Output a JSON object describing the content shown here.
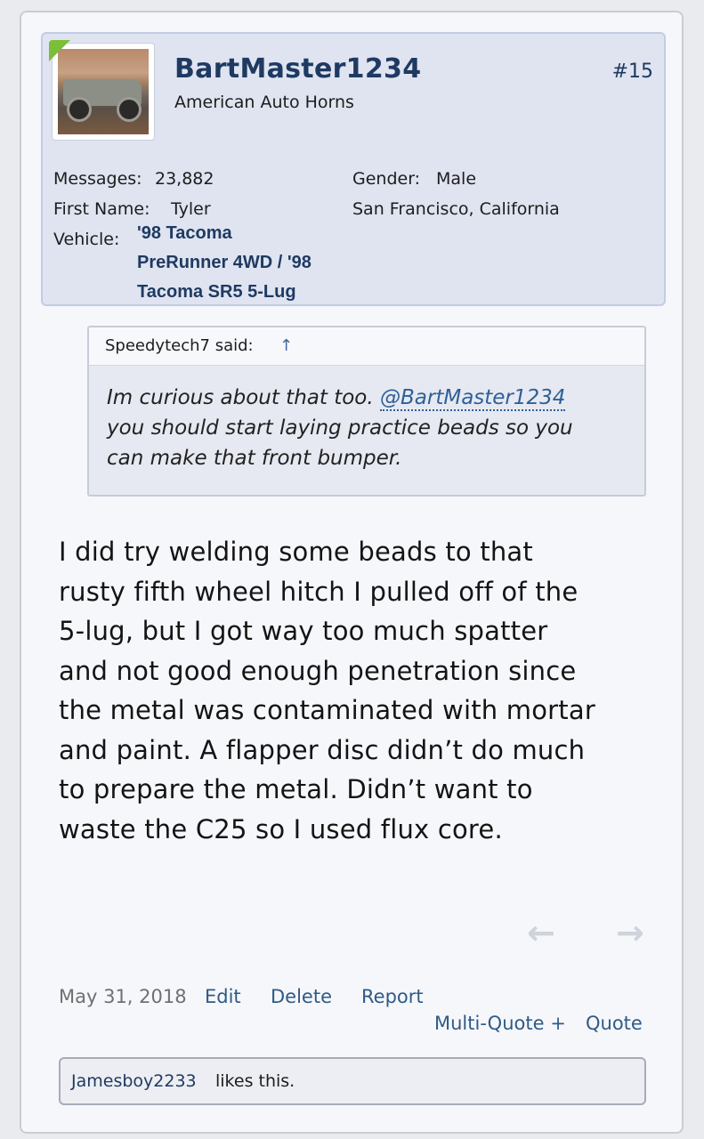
{
  "post": {
    "author": {
      "name": "BartMaster1234",
      "title": "American Auto Horns",
      "messages_label": "Messages:",
      "messages_value": "23,882",
      "first_name_label": "First Name:",
      "first_name_value": "Tyler",
      "vehicle_label": "Vehicle:",
      "vehicle_lines": [
        "'98 Tacoma",
        "PreRunner 4WD / '98",
        "Tacoma SR5 5-Lug"
      ],
      "gender_label": "Gender:",
      "gender_value": "Male",
      "location": "San Francisco, California"
    },
    "number": "#15",
    "quote": {
      "author": "Speedytech7 said:",
      "arrow": "↑",
      "text_before_mention": "Im curious about that too. ",
      "mention": "@BartMaster1234",
      "text_lines": [
        "you should start laying practice beads so you",
        "can make that front bumper."
      ]
    },
    "message_lines": [
      "I did try welding some beads to that",
      "rusty fifth wheel hitch I pulled off of the",
      "5-lug, but I got way too much spatter",
      "and not good enough penetration since",
      "the metal was contaminated with mortar",
      "and paint. A flapper disc didn’t do much",
      "to prepare the metal. Didn’t want to",
      "waste the C25 so I used flux core."
    ],
    "date": "May 31, 2018",
    "actions": {
      "edit": "Edit",
      "delete": "Delete",
      "report": "Report",
      "multi_quote": "Multi-Quote +",
      "quote": "Quote"
    },
    "nav": {
      "prev_icon": "arrow-left",
      "next_icon": "arrow-right",
      "prev_glyph": "←",
      "next_glyph": "→"
    },
    "likes": {
      "user": "Jamesboy2233",
      "text": "likes this."
    }
  }
}
